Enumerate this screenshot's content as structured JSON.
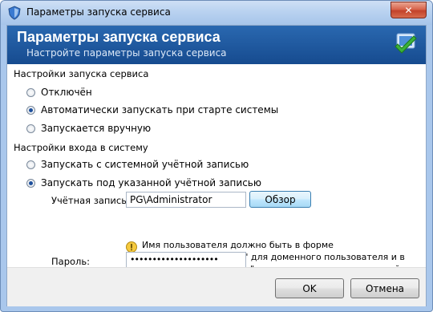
{
  "window": {
    "title": "Параметры запуска сервиса",
    "close_glyph": "✕"
  },
  "header": {
    "title": "Параметры запуска сервиса",
    "subtitle": "Настройте параметры запуска сервиса"
  },
  "startup": {
    "section_label": "Настройки запуска сервиса",
    "options": [
      {
        "label": "Отключён",
        "selected": false
      },
      {
        "label": "Автоматически запускать при старте системы",
        "selected": true
      },
      {
        "label": "Запускается вручную",
        "selected": false
      }
    ]
  },
  "logon": {
    "section_label": "Настройки входа в систему",
    "options": [
      {
        "label": "Запускать с системной учётной записью",
        "selected": false
      },
      {
        "label": "Запускать под указанной учётной записью",
        "selected": true
      }
    ],
    "account_label": "Учётная запись:",
    "account_value": "PG\\Administrator",
    "browse_label": "Обзор",
    "hint": "Имя пользователя должно быть в форме \"Домен\\Пользователь\" для доменного пользователя и в форме \".\\Пользователь\" для локальных пользователей",
    "password_label": "Пароль:",
    "password_value": "••••••••••••••••••••"
  },
  "footer": {
    "ok_label": "OK",
    "cancel_label": "Отмена"
  },
  "colors": {
    "header_bg": "#1b559f",
    "frame": "#a9c7ec",
    "accent": "#3c7fb1"
  }
}
